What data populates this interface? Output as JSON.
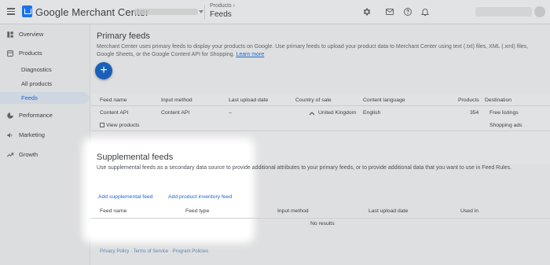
{
  "topbar": {
    "brand": "Google Merchant Center",
    "breadcrumb_parent": "Products",
    "breadcrumb_arrow": "›",
    "breadcrumb_current": "Feeds",
    "icons": [
      "settings-icon",
      "mail-icon",
      "help-icon",
      "notifications-icon"
    ]
  },
  "sidebar": {
    "items": [
      {
        "label": "Overview",
        "icon": "overview-icon"
      },
      {
        "label": "Products",
        "icon": "products-icon"
      },
      {
        "label": "Diagnostics"
      },
      {
        "label": "All products"
      },
      {
        "label": "Feeds",
        "active": true
      },
      {
        "label": "Performance",
        "icon": "performance-icon"
      },
      {
        "label": "Marketing",
        "icon": "marketing-icon"
      },
      {
        "label": "Growth",
        "icon": "growth-icon"
      }
    ]
  },
  "primary": {
    "title": "Primary feeds",
    "desc_line1": "Merchant Center uses primary feeds to display your products on Google. Use primary feeds to upload your product data to Merchant Center using text (.txt) files, XML (.xml) files,",
    "desc_line2": "Google Sheets, or the Google Content API for Shopping.",
    "learn_more": "Learn more",
    "add_label": "+",
    "columns": [
      "Feed name",
      "Input method",
      "Last upload date",
      "Country of sale",
      "Content language",
      "Products",
      "Destination"
    ],
    "row": {
      "feed_name": "Content API",
      "input_method": "Content API",
      "last_upload": "–",
      "country": "United Kingdom",
      "language": "English",
      "products": "354",
      "destination_1": "Free listings",
      "destination_2": "Shopping ads"
    },
    "view_products": "View products"
  },
  "supplemental": {
    "title": "Supplemental feeds",
    "desc": "Use supplemental feeds as a secondary data source to provide additional attributes to your primary feeds, or to provide additional data that you want to use in Feed Rules.",
    "add_supplemental": "Add supplemental feed",
    "add_inventory": "Add product inventory feed",
    "columns": [
      "Feed name",
      "Feed type",
      "Input method",
      "Last upload date",
      "Used in"
    ],
    "empty": "No results"
  },
  "footer": {
    "privacy": "Privacy Policy",
    "sep": "·",
    "terms": "Terms of Service",
    "policies": "Program Policies"
  },
  "colors": {
    "accent": "#1a73e8",
    "link": "#1967d2",
    "spotlight": "#ffffff"
  }
}
